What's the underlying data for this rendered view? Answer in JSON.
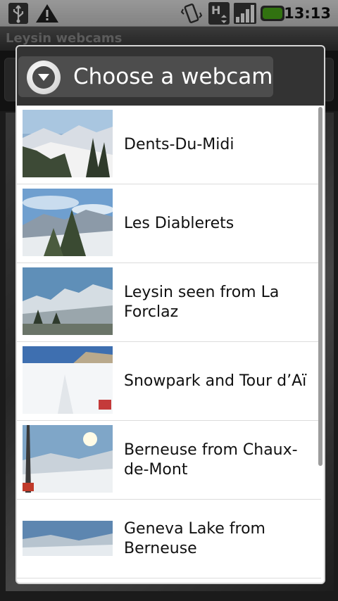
{
  "status_bar": {
    "time": "13:13",
    "icons": [
      "usb-icon",
      "warning-icon",
      "vibrate-icon",
      "hspa-data-icon",
      "signal-icon",
      "battery-icon"
    ],
    "network_type": "H"
  },
  "app": {
    "title": "Leysin webcams"
  },
  "dialog": {
    "title": "Choose a webcam",
    "icon": "dropdown-circle-icon",
    "items": [
      {
        "label": "Dents-Du-Midi"
      },
      {
        "label": "Les Diablerets"
      },
      {
        "label": "Leysin seen from La Forclaz"
      },
      {
        "label": "Snowpark and Tour d’Aï"
      },
      {
        "label": "Berneuse from Chaux-de-Mont"
      },
      {
        "label": "Geneva Lake from Berneuse"
      }
    ]
  },
  "colors": {
    "header_bg": "#333333",
    "list_bg": "#ffffff",
    "battery": "#4caf1a"
  }
}
